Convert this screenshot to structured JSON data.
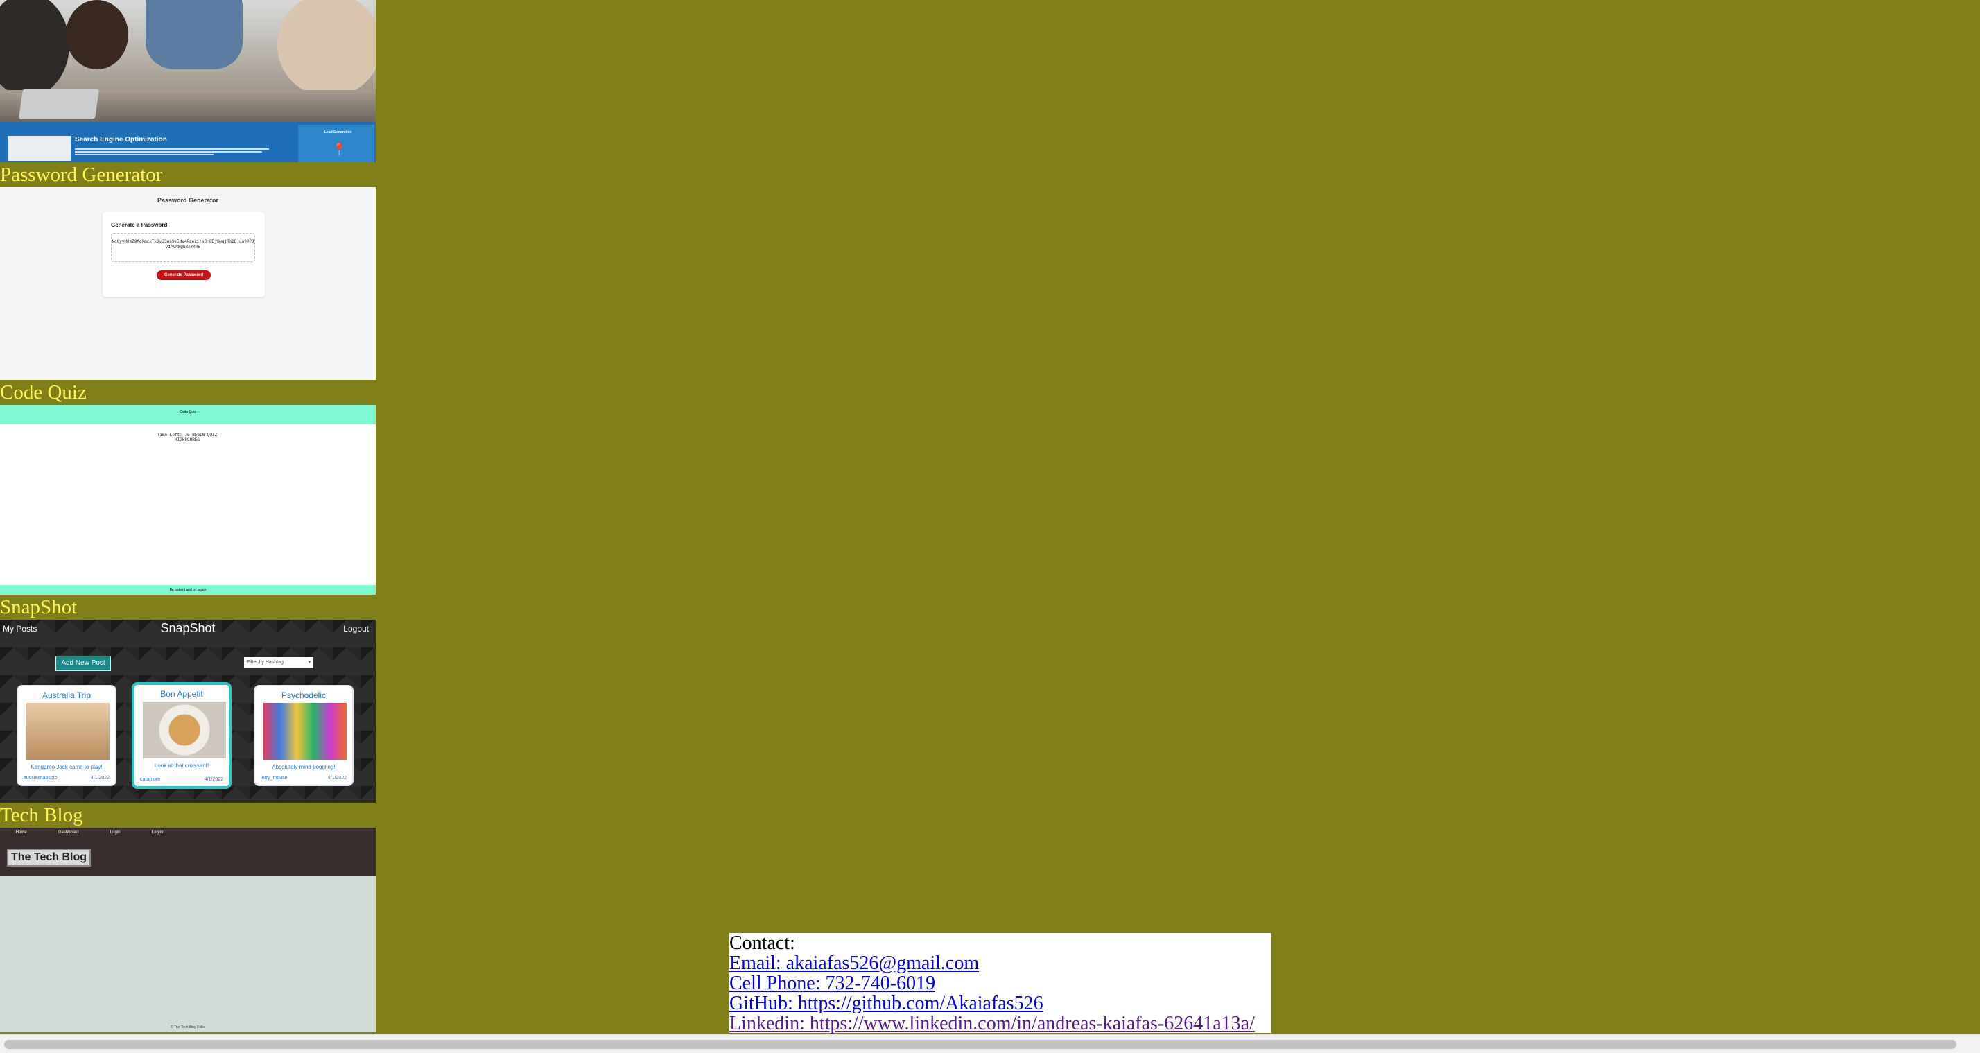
{
  "projects": [
    {
      "key": "seo",
      "title": "",
      "seo_heading": "Search Engine Optimization",
      "side_heading": "Lead Generation"
    },
    {
      "key": "password",
      "title": "Password Generator",
      "header": "Password Generator",
      "card_heading": "Generate a Password",
      "password_value": "Nq8yvH8sZ9fdXmcxTk3vJ3waSk5dW4RaeL1!sJ_0Ej%wqjR%2D+ua9#P8V1^VRW@bSxY4R8",
      "button_label": "Generate Password"
    },
    {
      "key": "quiz",
      "title": "Code Quiz",
      "header_text": "Code Quiz",
      "center_text": "Time Left: 75 BEGIN QUIZ HIGHSCORES",
      "footer_text": "Be patient and try again"
    },
    {
      "key": "snapshot",
      "title": "SnapShot",
      "nav_left": "My Posts",
      "nav_center": "SnapShot",
      "nav_right": "Logout",
      "add_button": "Add New Post",
      "filter_placeholder": "Filter by Hashtag",
      "posts": [
        {
          "title": "Australia Trip",
          "caption": "Kangaroo Jack came to play!",
          "user": "aussiesnapsoto",
          "date": "4/1/2022"
        },
        {
          "title": "Bon Appetit",
          "caption": "Look at that croissant!",
          "user": "catamore",
          "date": "4/1/2022"
        },
        {
          "title": "Psychodelic",
          "caption": "Absolutely mind boggling!",
          "user": "jerry_mouse",
          "date": "4/1/2022"
        }
      ]
    },
    {
      "key": "blog",
      "title": "Tech Blog",
      "links": [
        "Home",
        "Dashboard",
        "Login",
        "Logout"
      ],
      "logo": "The Tech Blog",
      "footer": "© The Tech Blog Folks"
    }
  ],
  "contact": {
    "heading": "Contact:",
    "email": "Email: akaiafas526@gmail.com",
    "phone": "Cell Phone: 732-740-6019",
    "github": "GitHub: https://github.com/Akaiafas526",
    "linkedin": "Linkedin: https://www.linkedin.com/in/andreas-kaiafas-62641a13a/"
  },
  "colors": {
    "page_background": "#817f17",
    "project_title": "#fff45c",
    "link": "#0000ee",
    "visited_link": "#551a8b"
  }
}
